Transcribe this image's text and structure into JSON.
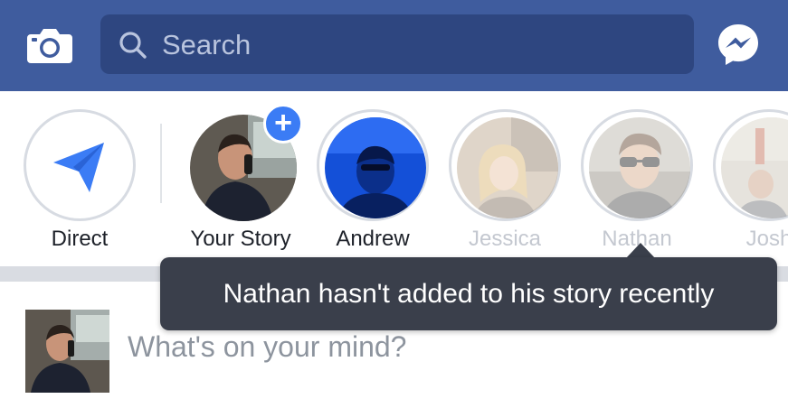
{
  "header": {
    "search": {
      "placeholder": "Search",
      "icon": "search-icon"
    },
    "camera_icon": "camera-icon",
    "messenger_icon": "messenger-icon",
    "colors": {
      "bar": "#3f5c9e",
      "search_field": "#2e4680"
    }
  },
  "stories": {
    "items": [
      {
        "label": "Direct",
        "icon": "paper-plane-icon",
        "state": "active"
      },
      {
        "label": "Your Story",
        "badge": "+",
        "state": "active"
      },
      {
        "label": "Andrew",
        "state": "active"
      },
      {
        "label": "Jessica",
        "state": "faded"
      },
      {
        "label": "Nathan",
        "state": "faded"
      },
      {
        "label": "Josh",
        "state": "faded"
      }
    ],
    "colors": {
      "accent": "#3b7cf5",
      "faded_label": "#c4c8d0"
    }
  },
  "tooltip": {
    "text": "Nathan hasn't added to his story recently"
  },
  "composer": {
    "prompt": "What's on your mind?"
  }
}
